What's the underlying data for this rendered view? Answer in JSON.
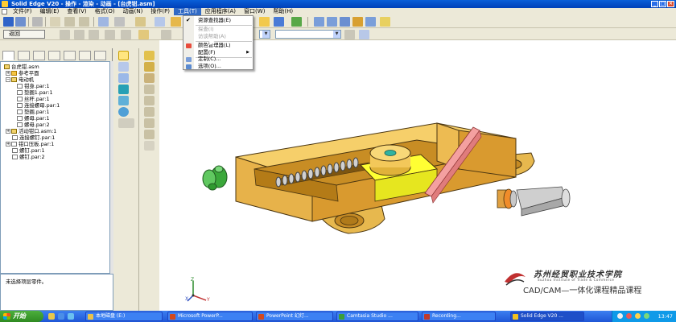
{
  "window": {
    "title": "Solid Edge V20 - 操作 - 渲染 - 动画 - [台虎钳.asm]",
    "btn_min": "_",
    "btn_max": "□",
    "btn_close": "×"
  },
  "menubar": {
    "items": [
      "文件(F)",
      "编辑(E)",
      "查看(V)",
      "格式(O)",
      "动画(N)",
      "操作(P)",
      "工具(T)",
      "应用程序(A)",
      "窗口(W)",
      "帮助(H)"
    ],
    "active_index": 6
  },
  "toolbar": {
    "return_label": "返回"
  },
  "tools_menu": {
    "items": [
      {
        "label": "资源查找器(E)",
        "checked": true,
        "disabled": false
      },
      {
        "label": "探查(I)",
        "checked": false,
        "disabled": true
      },
      {
        "label": "访谈帮助(A)",
        "checked": false,
        "disabled": true
      },
      {
        "label": "颜色管理器(L)",
        "checked": false,
        "disabled": false
      },
      {
        "label": "配置(F)",
        "checked": false,
        "disabled": false,
        "submenu": true
      },
      {
        "label": "定制(C)...",
        "checked": false,
        "disabled": false
      },
      {
        "label": "选项(O)...",
        "checked": false,
        "disabled": false
      }
    ],
    "check_mark": "✔",
    "submenu_arrow": "▶"
  },
  "tree": {
    "rows": [
      {
        "label": "台虎钳.asm",
        "indent": 0,
        "icon": "assembly",
        "expander": ""
      },
      {
        "label": "参考平面",
        "indent": 1,
        "icon": "plane",
        "expander": "+"
      },
      {
        "label": "电动机",
        "indent": 1,
        "icon": "assembly",
        "expander": "−"
      },
      {
        "label": "钳身.par:1",
        "indent": 2,
        "icon": "part",
        "expander": ""
      },
      {
        "label": "垫圈1.par:1",
        "indent": 2,
        "icon": "part",
        "expander": ""
      },
      {
        "label": "丝杆.par:1",
        "indent": 2,
        "icon": "part",
        "expander": ""
      },
      {
        "label": "连接螺母.par:1",
        "indent": 2,
        "icon": "part",
        "expander": ""
      },
      {
        "label": "垫圈.par:1",
        "indent": 2,
        "icon": "part",
        "expander": ""
      },
      {
        "label": "螺母.par:1",
        "indent": 2,
        "icon": "part",
        "expander": ""
      },
      {
        "label": "螺母.par:2",
        "indent": 2,
        "icon": "part",
        "expander": ""
      },
      {
        "label": "活动钳口.asm:1",
        "indent": 1,
        "icon": "assembly",
        "expander": "+"
      },
      {
        "label": "连接螺钉.par:1",
        "indent": 1,
        "icon": "part",
        "expander": ""
      },
      {
        "label": "钳口压板.par:1",
        "indent": 1,
        "icon": "part",
        "expander": "+"
      },
      {
        "label": "螺钉.par:1",
        "indent": 1,
        "icon": "part",
        "expander": ""
      },
      {
        "label": "螺钉.par:2",
        "indent": 1,
        "icon": "part",
        "expander": ""
      }
    ]
  },
  "prompt": {
    "text": "未选择项层零件。"
  },
  "triad": {
    "x": "X",
    "y": "Y",
    "z": "Z"
  },
  "watermark": {
    "school_cn": "苏州经贸职业技术学院",
    "school_en": "Suzhou Institute of Trade & Commerce",
    "course": "CAD/CAM—一体化课程精品课程"
  },
  "taskbar": {
    "start_label": "开始",
    "tasks": [
      {
        "label": "本地磁盘 (E:)",
        "icon_color": "#e9c24a"
      },
      {
        "label": "Microsoft PowerP...",
        "icon_color": "#d2481d"
      },
      {
        "label": "PowerPoint 幻灯...",
        "icon_color": "#d2481d"
      },
      {
        "label": "Camtasia Studio ...",
        "icon_color": "#3a9e3a"
      },
      {
        "label": "Recording...",
        "icon_color": "#c0392b"
      },
      {
        "label": "Solid Edge V20 ...",
        "icon_color": "#f0c020"
      }
    ],
    "active_task_index": 5,
    "clock": "13:47"
  },
  "colors": {
    "menu_highlight": "#316ac5",
    "part_body": "#f2c75c",
    "part_dark": "#d49a2c",
    "jaw_yellow": "#ffff33",
    "taskbar_blue": "#2558d8"
  }
}
